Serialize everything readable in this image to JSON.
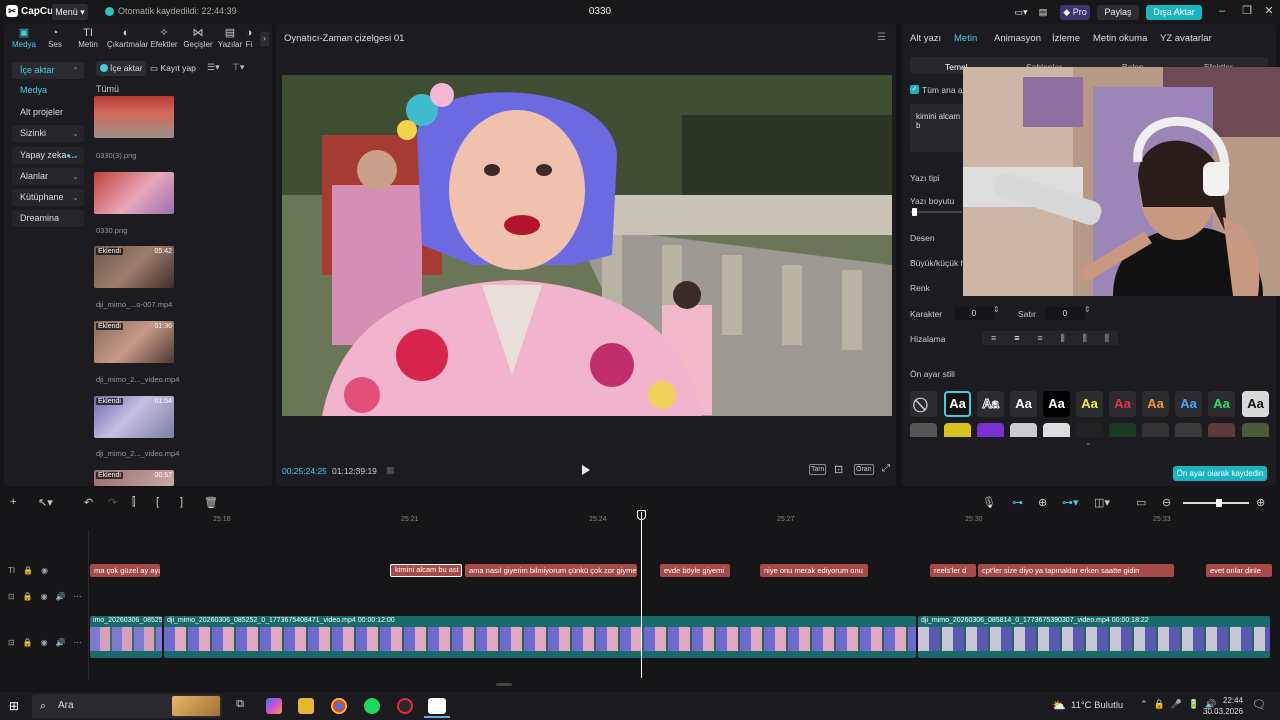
{
  "titlebar": {
    "app_name": "CapCut",
    "menu_label": "Menü",
    "autosave_text": "Otomatik kaydedildi: 22:44:39",
    "project_title": "0330",
    "pro_label": "Pro",
    "share_label": "Paylaş",
    "export_label": "Dışa Aktar"
  },
  "left_panel": {
    "tabs": [
      {
        "label": "Medya"
      },
      {
        "label": "Ses"
      },
      {
        "label": "Metin"
      },
      {
        "label": "Çıkartmalar"
      },
      {
        "label": "Efektler"
      },
      {
        "label": "Geçişler"
      },
      {
        "label": "Yazılar"
      },
      {
        "label": "Fi"
      }
    ],
    "sidebar": [
      {
        "label": "İçe aktar"
      },
      {
        "label": "Medya"
      },
      {
        "label": "Alt projeler"
      },
      {
        "label": "Sizinki"
      },
      {
        "label": "Yapay zeka ..."
      },
      {
        "label": "Alanlar"
      },
      {
        "label": "Kütüphane"
      },
      {
        "label": "Dreamina"
      }
    ],
    "import_label": "İçe aktar",
    "record_label": "Kayıt yap",
    "all_label": "Tümü",
    "media": [
      {
        "name": "0330(3).png",
        "badge": "",
        "duration": ""
      },
      {
        "name": "0330.png",
        "badge": "",
        "duration": ""
      },
      {
        "name": "dji_mimo_...o-007.mp4",
        "badge": "Eklendi",
        "duration": "05:42"
      },
      {
        "name": "dji_mimo_2..._video.mp4",
        "badge": "Eklendi",
        "duration": "01:36"
      },
      {
        "name": "dji_mimo_2..._video.mp4",
        "badge": "Eklendi",
        "duration": "01:54"
      },
      {
        "name": "",
        "badge": "Eklendi",
        "duration": "00:57"
      }
    ]
  },
  "player": {
    "title": "Oynatıcı-Zaman çizelgesi 01",
    "current_time": "00:25:24:25",
    "total_time": "01:12:39:19",
    "full_label": "Tam",
    "ratio_label": "Oran"
  },
  "right_panel": {
    "tabs": [
      {
        "label": "Alt yazı"
      },
      {
        "label": "Metin"
      },
      {
        "label": "Animasyon"
      },
      {
        "label": "İzleme"
      },
      {
        "label": "Metin okuma"
      },
      {
        "label": "YZ avatarlar"
      }
    ],
    "subtabs": [
      {
        "label": "Temel"
      },
      {
        "label": "Şablonlar"
      },
      {
        "label": "Balon"
      },
      {
        "label": "Efektler"
      }
    ],
    "all_main_label": "Tüm ana alt",
    "text_value": "kimini alcam b",
    "labels": {
      "font": "Yazı tipi",
      "size": "Yazı boyutu",
      "pattern": "Desen",
      "case": "Büyük/küçük h",
      "color": "Renk",
      "char": "Karakter",
      "line": "Satır",
      "align": "Hizalama",
      "preset": "Ön ayar stili"
    },
    "char_value": "0",
    "line_value": "0",
    "preset_glyph": "Aa",
    "save_preset_label": "Ön ayar olarak kaydedin",
    "accent": "#19b6c2"
  },
  "timeline": {
    "ruler": [
      "25:18",
      "25:21",
      "25:24",
      "25:27",
      "25:30",
      "25:33"
    ],
    "subtitles": [
      {
        "text": "ma çok güzel ay ayaklar"
      },
      {
        "text": "kimini alcam bu ast"
      },
      {
        "text": "ama nasıl giyerim bilmiyorum çünkü çok zor giymek"
      },
      {
        "text": "evde böyle giyemi"
      },
      {
        "text": "niye onu merak ediyorum onu"
      },
      {
        "text": "reels'ler d"
      },
      {
        "text": "cpt'ler size diyo ya tapınaklar erken saatte gidin"
      },
      {
        "text": "evet onlar dinle"
      }
    ],
    "video_clips": [
      {
        "label": "imo_20260306_085252_0"
      },
      {
        "label": "dji_mimo_20260306_085252_0_1773675408471_video.mp4   00:00:12:00"
      },
      {
        "label": "dji_mimo_20260306_085814_0_1773675390307_video.mp4   00:00:18:22"
      }
    ]
  },
  "taskbar": {
    "search_placeholder": "Ara",
    "weather": "11°C  Bulutlu",
    "time": "22:44",
    "date": "30.03.2026"
  }
}
